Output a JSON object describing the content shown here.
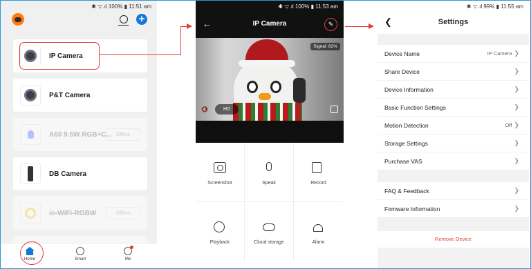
{
  "panel1": {
    "status": "✱ ᯤ.ıl 100% ▮ 11:51 am",
    "devices": [
      {
        "name": "IP Camera",
        "state": "online"
      },
      {
        "name": "P&T Camera",
        "state": "online"
      },
      {
        "name": "A60 9.5W RGB+C...",
        "state": "offline"
      },
      {
        "name": "DB Camera",
        "state": "online"
      },
      {
        "name": "io-WiFi-RGBW",
        "state": "offline"
      },
      {
        "name": "",
        "state": "offline"
      }
    ],
    "offline_label": "Offline",
    "tabs": [
      "Home",
      "Smart",
      "Me"
    ],
    "accent": "#1577d6",
    "highlight": "#e23b3b"
  },
  "panel2": {
    "status": "✱ ᯤ.ıl 100% ▮ 11:53 am",
    "title": "IP Camera",
    "signal": "Signal: 82%",
    "quality": "HD",
    "actions": [
      "Screenshot",
      "Speak",
      "Record",
      "Playback",
      "Cloud storage",
      "Alarm"
    ]
  },
  "panel3": {
    "status": "✱ ᯤ.ıl 99% ▮ 11:55 am",
    "title": "Settings",
    "rows": [
      {
        "label": "Device Name",
        "value": "IP Camera"
      },
      {
        "label": "Share Device",
        "value": ""
      },
      {
        "label": "Device Information",
        "value": ""
      },
      {
        "label": "Basic Function Settings",
        "value": ""
      },
      {
        "label": "Motion Detection",
        "value": "Off"
      },
      {
        "label": "Storage Settings",
        "value": ""
      },
      {
        "label": "Purchase VAS",
        "value": ""
      }
    ],
    "rows2": [
      {
        "label": "FAQ & Feedback",
        "value": ""
      },
      {
        "label": "Firmware Information",
        "value": ""
      }
    ],
    "remove": "Remove Device",
    "danger": "#e0442f"
  }
}
